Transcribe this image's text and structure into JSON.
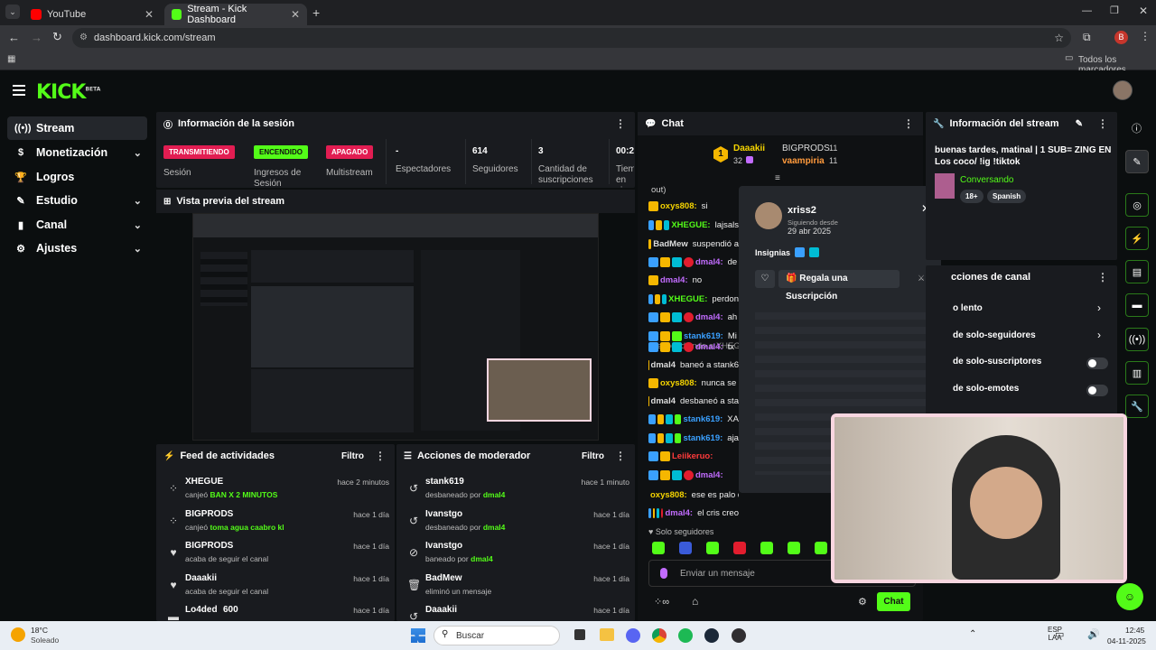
{
  "browser": {
    "tabs": [
      {
        "label": "YouTube",
        "active": false
      },
      {
        "label": "Stream - Kick Dashboard",
        "active": true
      }
    ],
    "url": "dashboard.kick.com/stream",
    "bookmarks_label": "Todos los marcadores",
    "profile_initial": "B"
  },
  "kick": {
    "logo": "KICK",
    "logo_tag": "BETA"
  },
  "sidebar": {
    "items": [
      {
        "label": "Stream",
        "icon": "stream-icon",
        "active": true
      },
      {
        "label": "Monetización",
        "icon": "money-icon",
        "chevron": true
      },
      {
        "label": "Logros",
        "icon": "trophy-icon"
      },
      {
        "label": "Estudio",
        "icon": "studio-icon",
        "chevron": true
      },
      {
        "label": "Canal",
        "icon": "channel-icon",
        "chevron": true
      },
      {
        "label": "Ajustes",
        "icon": "gear-icon",
        "chevron": true
      }
    ]
  },
  "session": {
    "title": "Información de la sesión",
    "statuses": [
      {
        "badge": "TRANSMITIENDO",
        "label": "Sesión",
        "color": "#e21d52"
      },
      {
        "badge": "ENCENDIDO",
        "label": "Ingresos de Sesión",
        "color": "#53fc18"
      },
      {
        "badge": "APAGADO",
        "label": "Multistream",
        "color": "#e21d52"
      }
    ],
    "stats": [
      {
        "value": "-",
        "label": "Espectadores"
      },
      {
        "value": "614",
        "label": "Seguidores"
      },
      {
        "value": "3",
        "label": "Cantidad de suscripciones"
      },
      {
        "value": "00:2",
        "label": "Tiem en vi"
      }
    ]
  },
  "preview": {
    "title": "Vista previa del stream"
  },
  "feed": {
    "title": "Feed de actividades",
    "filter": "Filtro",
    "rows": [
      {
        "name": "XHEGUE",
        "action": "canjeó",
        "highlight": "BAN X 2 MINUTOS",
        "time": "hace 2 minutos",
        "icon": "redeem-icon"
      },
      {
        "name": "BIGPRODS",
        "action": "canjeó",
        "highlight": "toma agua caabro kl",
        "time": "hace 1 día",
        "icon": "redeem-icon"
      },
      {
        "name": "BIGPRODS",
        "action": "acaba de seguir el canal",
        "highlight": "",
        "time": "hace 1 día",
        "icon": "heart-icon"
      },
      {
        "name": "Daaakii",
        "action": "acaba de seguir el canal",
        "highlight": "",
        "time": "hace 1 día",
        "icon": "heart-icon"
      },
      {
        "name": "Lo4ded",
        "action": "600",
        "highlight": "",
        "time": "hace 1 día",
        "icon": "kicks-icon"
      }
    ]
  },
  "modactions": {
    "title": "Acciones de moderador",
    "filter": "Filtro",
    "rows": [
      {
        "name": "stank619",
        "action": "desbaneado por",
        "by": "dmal4",
        "time": "hace 1 minuto",
        "icon": "undo-icon"
      },
      {
        "name": "Ivanstgo",
        "action": "desbaneado por",
        "by": "dmal4",
        "time": "hace 1 día",
        "icon": "undo-icon"
      },
      {
        "name": "Ivanstgo",
        "action": "baneado por",
        "by": "dmal4",
        "time": "hace 1 día",
        "icon": "ban-icon"
      },
      {
        "name": "BadMew",
        "action": "eliminó un mensaje",
        "by": "",
        "time": "hace 1 día",
        "icon": "trash-icon"
      },
      {
        "name": "Daaakii",
        "action": "",
        "by": "",
        "time": "hace 1 día",
        "icon": "undo-icon"
      }
    ]
  },
  "chat": {
    "title": "Chat",
    "top_gifter_1": {
      "name": "Daaakii",
      "count": "32"
    },
    "top_gifter_2": {
      "name": "BIGPRODS",
      "count": "11"
    },
    "top_gifter_3": {
      "name": "vaampiria",
      "count": "11"
    },
    "lines": [
      {
        "user": "",
        "text": "out)",
        "color": "#ccc"
      },
      {
        "user": "oxys808:",
        "text": "si",
        "color": "#f5d400"
      },
      {
        "user": "XHEGUE:",
        "text": "lajsals",
        "color": "#53fc18"
      },
      {
        "user": "BadMew",
        "text": "suspendió a",
        "color": "#ddd"
      },
      {
        "user": "dmal4:",
        "text": "de",
        "color": "#c26cff"
      },
      {
        "user": "dmal4:",
        "text": "no",
        "color": "#c26cff"
      },
      {
        "user": "XHEGUE:",
        "text": "perdon",
        "color": "#53fc18"
      },
      {
        "user": "dmal4:",
        "text": "ah",
        "color": "#c26cff"
      },
      {
        "user": "stank619:",
        "text": "Mi",
        "color": "#3aa0ff"
      },
      {
        "user": "",
        "text": "Respondiendo a XHEG",
        "color": "#888"
      },
      {
        "user": "dmal4:",
        "text": "tx",
        "color": "#c26cff"
      },
      {
        "user": "dmal4",
        "text": "baneó a stank6",
        "color": "#ddd"
      },
      {
        "user": "oxys808:",
        "text": "nunca se",
        "color": "#f5d400"
      },
      {
        "user": "dmal4",
        "text": "desbaneó a sta",
        "color": "#ddd"
      },
      {
        "user": "stank619:",
        "text": "XA",
        "color": "#3aa0ff"
      },
      {
        "user": "stank619:",
        "text": "aja",
        "color": "#3aa0ff"
      },
      {
        "user": "Leiikeruo:",
        "text": "",
        "color": "#ff3b3b"
      },
      {
        "user": "dmal4:",
        "text": "",
        "color": "#c26cff"
      },
      {
        "user": "oxys808:",
        "text": "ese es palo de ese weon",
        "color": "#f5d400"
      },
      {
        "user": "dmal4:",
        "text": "el cris creo",
        "color": "#c26cff"
      }
    ],
    "mode_label": "Solo seguidores",
    "input_placeholder": "Enviar un mensaje",
    "send_label": "Chat"
  },
  "popup": {
    "username": "xriss2",
    "following_label": "Siguiendo desde",
    "following_date": "29 abr 2025",
    "insignias_label": "Insignias",
    "gift_button": "Regala una Suscripción"
  },
  "streaminfo": {
    "title": "Información del stream",
    "stream_title": "buenas tardes, matinal | 1 SUB= ZING EN Los coco/ !ig !tiktok",
    "category": "Conversando",
    "tags": [
      "18+",
      "Spanish"
    ]
  },
  "channelactions": {
    "title": "cciones de canal",
    "items": [
      {
        "label": "o lento",
        "control": "chevron"
      },
      {
        "label": "de solo-seguidores",
        "control": "chevron"
      },
      {
        "label": "de solo-suscriptores",
        "control": "toggle"
      },
      {
        "label": "de solo-emotes",
        "control": "toggle"
      }
    ]
  },
  "taskbar": {
    "weather_temp": "18°C",
    "weather_desc": "Soleado",
    "search_placeholder": "Buscar",
    "lang": "ESP",
    "lang2": "LAA",
    "time": "12:45",
    "date": "04-11-2025"
  },
  "colors": {
    "kick_green": "#53fc18",
    "live_red": "#e21d52",
    "panel": "#191b1f"
  }
}
